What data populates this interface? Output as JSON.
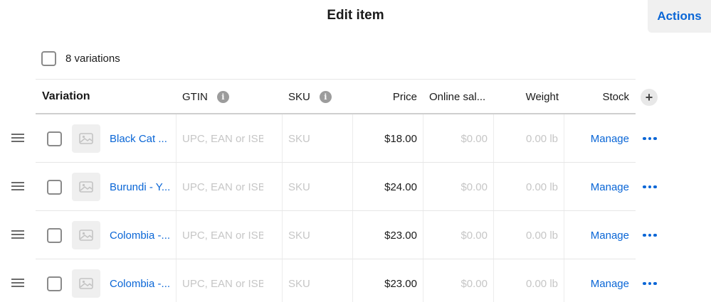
{
  "header": {
    "title": "Edit item",
    "actions_label": "Actions"
  },
  "select_all": {
    "label": "8 variations"
  },
  "table": {
    "columns": {
      "variation": "Variation",
      "gtin": "GTIN",
      "sku": "SKU",
      "price": "Price",
      "online_sale": "Online sal...",
      "weight": "Weight",
      "stock": "Stock"
    },
    "placeholders": {
      "gtin": "UPC, EAN or ISBN",
      "sku": "SKU",
      "online_sale": "$0.00",
      "weight": "0.00",
      "weight_unit": "lb"
    },
    "rows": [
      {
        "name": "Black Cat ...",
        "price": "$18.00",
        "stock_action": "Manage"
      },
      {
        "name": "Burundi - Y...",
        "price": "$24.00",
        "stock_action": "Manage"
      },
      {
        "name": "Colombia -...",
        "price": "$23.00",
        "stock_action": "Manage"
      },
      {
        "name": "Colombia -...",
        "price": "$23.00",
        "stock_action": "Manage"
      }
    ]
  },
  "icons": {
    "info": "info-icon",
    "add_column": "plus-icon",
    "drag": "drag-handle-icon",
    "thumbnail": "image-placeholder-icon",
    "more": "more-horizontal-icon"
  },
  "colors": {
    "accent": "#0a66d6",
    "placeholder": "#c6c6c6",
    "actions_bg": "#f0f0f0"
  }
}
